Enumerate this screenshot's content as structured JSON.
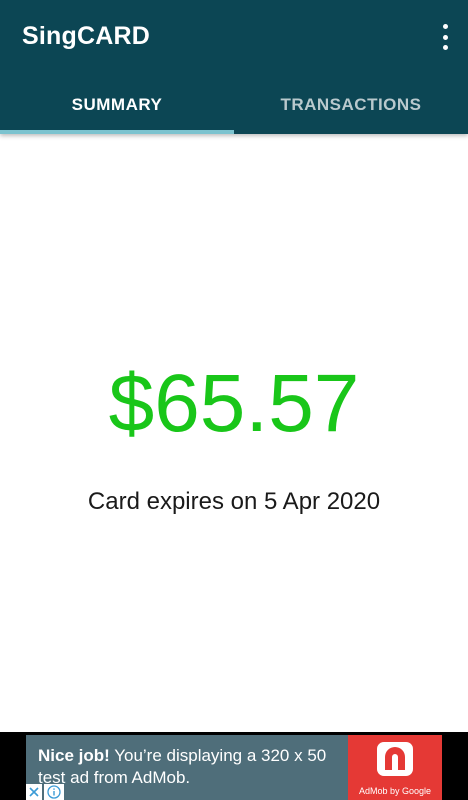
{
  "app": {
    "title": "SingCARD",
    "menu_icon": "overflow-menu-icon"
  },
  "tabs": [
    {
      "label": "SUMMARY",
      "active": true
    },
    {
      "label": "TRANSACTIONS",
      "active": false
    }
  ],
  "summary": {
    "balance": "$65.57",
    "expiry_text": "Card expires on 5 Apr 2020"
  },
  "ad": {
    "headline": "Nice job!",
    "body": " You’re displaying a 320 x 50 test ad from AdMob.",
    "logo_caption": "AdMob by Google",
    "close_icon": "close-icon",
    "info_icon": "info-icon"
  },
  "colors": {
    "app_bar": "#0c4654",
    "tab_indicator": "#7cc3cf",
    "balance": "#19c619",
    "ad_background": "#4f6e7a",
    "ad_logo_background": "#e53935"
  }
}
